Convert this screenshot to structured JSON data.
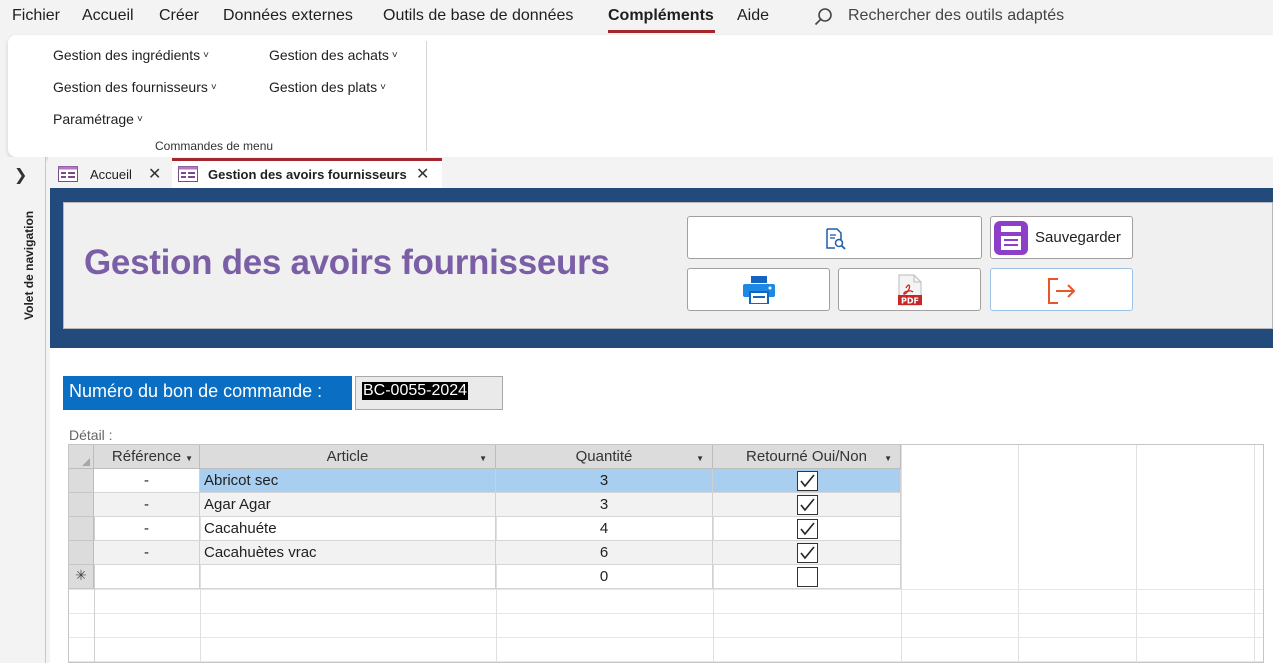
{
  "menubar": {
    "items": [
      "Fichier",
      "Accueil",
      "Créer",
      "Données externes",
      "Outils de base de données",
      "Compléments",
      "Aide"
    ],
    "active": "Compléments",
    "search_placeholder": "Rechercher des outils adaptés"
  },
  "ribbon": {
    "commands": [
      {
        "label": "Gestion des ingrédients"
      },
      {
        "label": "Gestion des achats"
      },
      {
        "label": "Gestion des fournisseurs"
      },
      {
        "label": "Gestion des plats"
      },
      {
        "label": "Paramétrage"
      }
    ],
    "group_label": "Commandes de menu"
  },
  "navpane": {
    "label": "Volet de navigation"
  },
  "tabs": [
    {
      "label": "Accueil",
      "active": false
    },
    {
      "label": "Gestion des avoirs fournisseurs",
      "active": true
    }
  ],
  "form": {
    "title": "Gestion des avoirs fournisseurs",
    "buttons": {
      "search_icon": "document-search-icon",
      "save_label": "Sauvegarder",
      "save_icon": "save-icon",
      "print_icon": "printer-icon",
      "pdf_icon": "pdf-icon",
      "pdf_text": "PDF",
      "exit_icon": "exit-icon"
    },
    "order_label": "Numéro du bon de commande :",
    "order_value": "BC-0055-2024",
    "detail_label": "Détail :"
  },
  "grid": {
    "columns": [
      "Référence",
      "Article",
      "Quantité",
      "Retourné Oui/Non"
    ],
    "rows": [
      {
        "reference": "-",
        "article": "Abricot sec",
        "quantite": "3",
        "retourne": true
      },
      {
        "reference": "-",
        "article": "Agar Agar",
        "quantite": "3",
        "retourne": true
      },
      {
        "reference": "-",
        "article": "Cacahuéte",
        "quantite": "4",
        "retourne": true
      },
      {
        "reference": "-",
        "article": "Cacahuètes vrac",
        "quantite": "6",
        "retourne": true
      }
    ],
    "new_row": {
      "marker": "✳",
      "quantite": "0",
      "retourne": false
    }
  },
  "colors": {
    "accent_underline": "#a4262c",
    "header_band": "#234a7d",
    "title": "#7a5ea6",
    "order_label_bg": "#0a6fc2",
    "selection": "#a9cff0"
  }
}
